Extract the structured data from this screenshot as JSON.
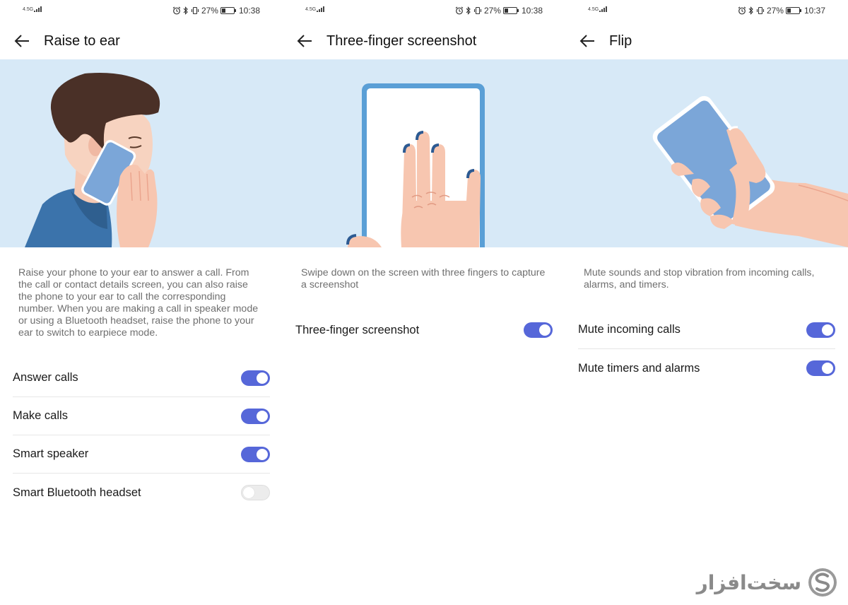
{
  "screens": [
    {
      "status": {
        "network": "4.5G",
        "battery": "27%",
        "time": "10:38"
      },
      "title": "Raise to ear",
      "description": "Raise your phone to your ear to answer a call. From the call or contact details screen, you can also raise the phone to your ear to call the corresponding number. When you are making a call in speaker mode or using a Bluetooth headset, raise the phone to your ear to switch to earpiece mode.",
      "settings": [
        {
          "label": "Answer calls",
          "enabled": true
        },
        {
          "label": "Make calls",
          "enabled": true
        },
        {
          "label": "Smart speaker",
          "enabled": true
        },
        {
          "label": "Smart Bluetooth headset",
          "enabled": false
        }
      ]
    },
    {
      "status": {
        "network": "4.5G",
        "battery": "27%",
        "time": "10:38"
      },
      "title": "Three-finger screenshot",
      "description": "Swipe down on the screen with three fingers to capture a screenshot",
      "settings": [
        {
          "label": "Three-finger screenshot",
          "enabled": true
        }
      ]
    },
    {
      "status": {
        "network": "4.5G",
        "battery": "27%",
        "time": "10:37"
      },
      "title": "Flip",
      "description": "Mute sounds and stop vibration from incoming calls, alarms, and timers.",
      "settings": [
        {
          "label": "Mute incoming calls",
          "enabled": true
        },
        {
          "label": "Mute timers and alarms",
          "enabled": true
        }
      ]
    }
  ],
  "watermark": {
    "text": "سخت‌افزار",
    "logo_icon": "s-logo-icon"
  },
  "colors": {
    "accent": "#5667d9",
    "hero_background": "#d7e9f7",
    "toggle_off": "#ececec",
    "description_text": "#6f6f6f"
  },
  "icons": [
    "back-arrow-icon",
    "alarm-icon",
    "bluetooth-icon",
    "vibrate-icon",
    "battery-icon",
    "signal-icon"
  ]
}
